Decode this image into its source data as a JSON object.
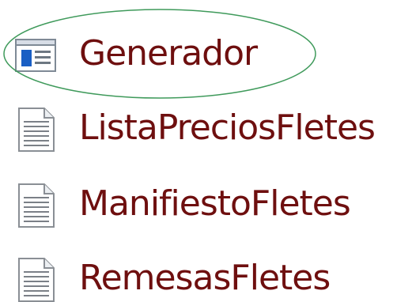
{
  "files": [
    {
      "name": "Generador",
      "icon": "application-window-icon"
    },
    {
      "name": "ListaPreciosFletes",
      "icon": "text-document-icon"
    },
    {
      "name": "ManifiestoFletes",
      "icon": "text-document-icon"
    },
    {
      "name": "RemesasFletes",
      "icon": "text-document-icon"
    }
  ],
  "colors": {
    "label_text": "#6e0f0f",
    "highlight_ellipse": "#3f9a5b",
    "app_icon_blue": "#1a5fc4"
  }
}
